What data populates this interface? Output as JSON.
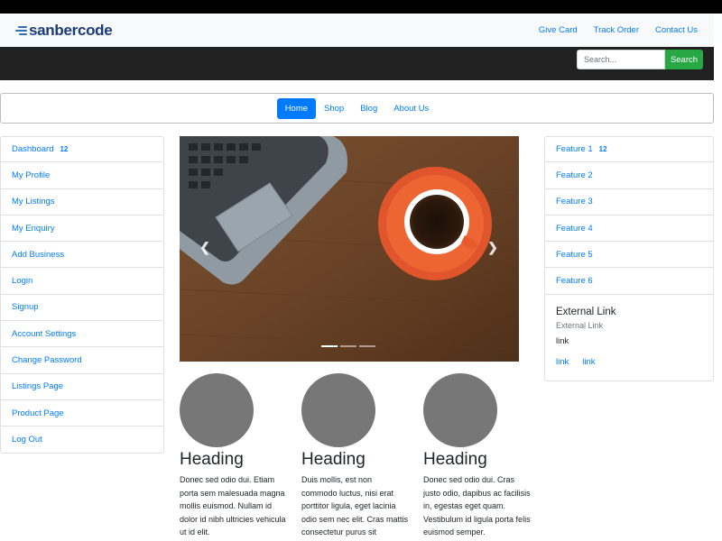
{
  "brand": {
    "name": "sanbercode"
  },
  "top_links": [
    "Give Card",
    "Track Order",
    "Contact Us"
  ],
  "search": {
    "placeholder": "Search...",
    "button_label": "Search"
  },
  "nav": {
    "items": [
      "Home",
      "Shop",
      "Blog",
      "About Us"
    ],
    "active": "Home"
  },
  "sidebar": {
    "items": [
      {
        "label": "Dashboard",
        "badge": "12"
      },
      {
        "label": "My Profile"
      },
      {
        "label": "My Listings"
      },
      {
        "label": "My Enquiry"
      },
      {
        "label": "Add Business"
      },
      {
        "label": "Login"
      },
      {
        "label": "Signup"
      },
      {
        "label": "Account Settings"
      },
      {
        "label": "Change Password"
      },
      {
        "label": "Listings Page"
      },
      {
        "label": "Product Page"
      },
      {
        "label": "Log Out"
      }
    ]
  },
  "carousel": {
    "prev_icon": "chevron-left",
    "next_icon": "chevron-right",
    "slide_count": 3,
    "active_index": 0
  },
  "features": [
    {
      "heading": "Heading",
      "text": "Donec sed odio dui. Etiam porta sem malesuada magna mollis euismod. Nullam id dolor id nibh ultricies vehicula ut id elit."
    },
    {
      "heading": "Heading",
      "text": "Duis mollis, est non commodo luctus, nisi erat porttitor ligula, eget lacinia odio sem nec elit. Cras mattis consectetur purus sit"
    },
    {
      "heading": "Heading",
      "text": "Donec sed odio dui. Cras justo odio, dapibus ac facilisis in, egestas eget quam. Vestibulum id ligula porta felis euismod semper."
    }
  ],
  "right_sidebar": {
    "items": [
      {
        "label": "Feature 1",
        "badge": "12"
      },
      {
        "label": "Feature 2"
      },
      {
        "label": "Feature 3"
      },
      {
        "label": "Feature 4"
      },
      {
        "label": "Feature 5"
      },
      {
        "label": "Feature 6"
      }
    ],
    "card": {
      "title": "External Link",
      "subtitle": "External Link",
      "text": "link",
      "links": [
        "link",
        "link"
      ]
    }
  },
  "colors": {
    "primary": "#007bff",
    "success": "#28a745",
    "dark": "#212121",
    "placeholder_circle": "#777777"
  }
}
